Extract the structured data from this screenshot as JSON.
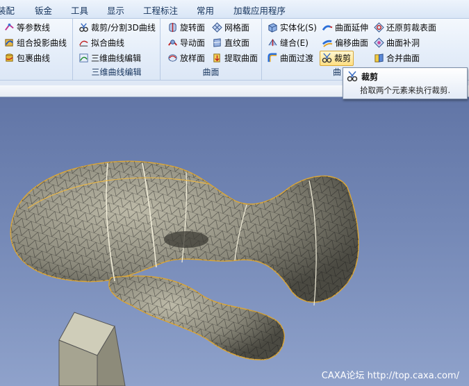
{
  "menu": [
    "装配",
    "钣金",
    "工具",
    "显示",
    "工程标注",
    "常用",
    "加载应用程序"
  ],
  "groups": {
    "curves": {
      "title": "",
      "items": [
        {
          "label": "等参数线",
          "icon": "iso-curve-icon"
        },
        {
          "label": "组合投影曲线",
          "icon": "projection-curve-icon"
        },
        {
          "label": "包裹曲线",
          "icon": "wrap-curve-icon"
        }
      ]
    },
    "curve3d_edit": {
      "title": "三维曲线编辑",
      "items": [
        {
          "label": "裁剪/分割3D曲线",
          "icon": "trim-3d-curve-icon"
        },
        {
          "label": "拟合曲线",
          "icon": "fit-curve-icon"
        },
        {
          "label": "三维曲线编辑",
          "icon": "edit-3d-curve-icon"
        }
      ]
    },
    "surface": {
      "title": "曲面",
      "items": [
        {
          "label": "旋转面",
          "icon": "revolve-surface-icon"
        },
        {
          "label": "网格面",
          "icon": "mesh-surface-icon"
        },
        {
          "label": "导动面",
          "icon": "sweep-surface-icon"
        },
        {
          "label": "直纹面",
          "icon": "ruled-surface-icon"
        },
        {
          "label": "放样面",
          "icon": "loft-surface-icon"
        },
        {
          "label": "提取曲面",
          "icon": "extract-surface-icon"
        }
      ]
    },
    "surface_edit": {
      "title": "曲",
      "items": [
        {
          "label": "实体化(S)",
          "icon": "solidify-icon"
        },
        {
          "label": "曲面延伸",
          "icon": "extend-surface-icon"
        },
        {
          "label": "还原剪裁表面",
          "icon": "restore-trim-icon"
        },
        {
          "label": "缝合(E)",
          "icon": "stitch-icon"
        },
        {
          "label": "偏移曲面",
          "icon": "offset-surface-icon"
        },
        {
          "label": "曲面补洞",
          "icon": "patch-hole-icon"
        },
        {
          "label": "曲面过渡",
          "icon": "blend-surface-icon"
        },
        {
          "label": "裁剪",
          "icon": "trim-icon"
        },
        {
          "label": "合并曲面",
          "icon": "merge-surface-icon"
        }
      ]
    }
  },
  "tooltip": {
    "title": "裁剪",
    "description": "拾取两个元素来执行裁剪."
  },
  "watermark": "CAXA论坛 http://top.caxa.com/",
  "colors": {
    "viewport_top": "#6175a6",
    "viewport_bottom": "#8fa2cb",
    "highlight": "#ffdf83",
    "model_surface": "#8c8a7c"
  }
}
